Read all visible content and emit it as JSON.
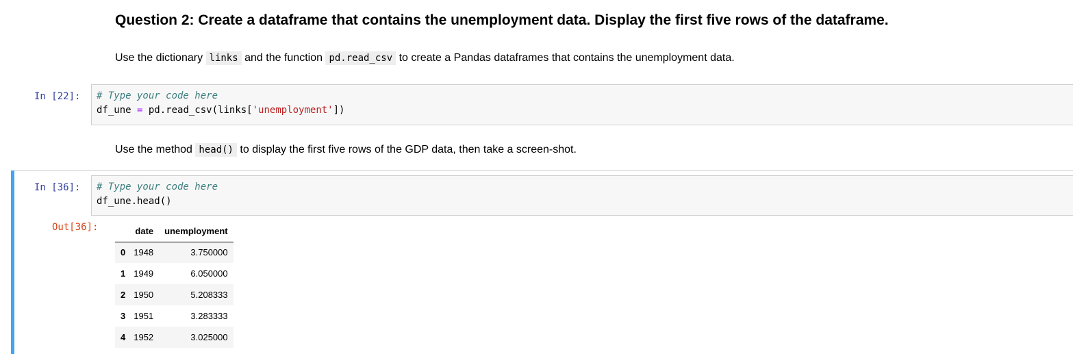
{
  "question": {
    "heading": "Question 2: Create a dataframe that contains the unemployment data. Display the first five rows of the dataframe."
  },
  "instruction1": {
    "t1": "Use the dictionary ",
    "c1": "links",
    "t2": " and the function ",
    "c2": "pd.read_csv",
    "t3": " to create a Pandas dataframes that contains the unemployment data."
  },
  "cell1": {
    "prompt": "In [22]:",
    "comment": "# Type your code here",
    "line2_var": "df_une",
    "line2_op": "=",
    "line2_call": " pd.read_csv(links[",
    "line2_str": "'unemployment'",
    "line2_end": "])"
  },
  "instruction2": {
    "t1": "Use the method ",
    "c1": "head()",
    "t2": " to display the first five rows of the GDP data, then take a screen-shot."
  },
  "cell2": {
    "prompt": "In [36]:",
    "comment": "# Type your code here",
    "line2": "df_une.head()",
    "out_prompt": "Out[36]:"
  },
  "dataframe": {
    "columns": [
      "",
      "date",
      "unemployment"
    ],
    "rows": [
      {
        "index": "0",
        "date": "1948",
        "unemployment": "3.750000"
      },
      {
        "index": "1",
        "date": "1949",
        "unemployment": "6.050000"
      },
      {
        "index": "2",
        "date": "1950",
        "unemployment": "5.208333"
      },
      {
        "index": "3",
        "date": "1951",
        "unemployment": "3.283333"
      },
      {
        "index": "4",
        "date": "1952",
        "unemployment": "3.025000"
      }
    ]
  },
  "colors": {
    "in_prompt": "#303f9f",
    "out_prompt": "#d84315",
    "selected_cell_bar": "#42a5f5",
    "code_background": "#f7f7f7"
  }
}
